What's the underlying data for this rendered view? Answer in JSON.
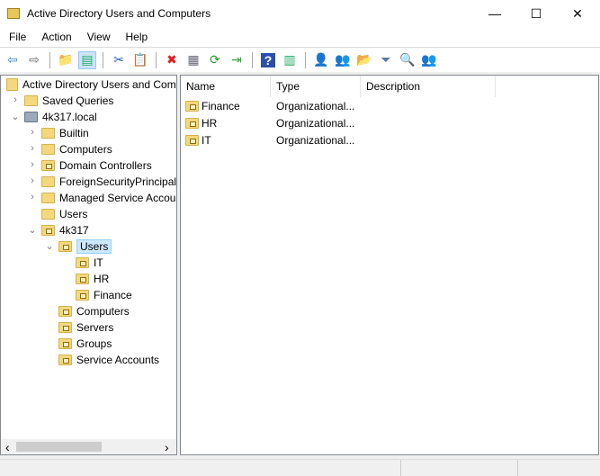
{
  "window": {
    "title": "Active Directory Users and Computers",
    "minimize": "—",
    "maximize": "☐",
    "close": "✕"
  },
  "menu": [
    "File",
    "Action",
    "View",
    "Help"
  ],
  "toolbar": [
    {
      "icon": "back-arrow-icon",
      "glyph": "⇦",
      "color": "#2b7fd8"
    },
    {
      "icon": "forward-arrow-icon",
      "glyph": "⇨",
      "color": "#666"
    },
    {
      "sep": true
    },
    {
      "icon": "up-folder-icon",
      "glyph": "📁",
      "color": "#c9a030"
    },
    {
      "icon": "show-console-tree-icon",
      "glyph": "▤",
      "color": "#2a6",
      "on": true
    },
    {
      "sep": true
    },
    {
      "icon": "cut-icon",
      "glyph": "✂",
      "color": "#2b5fb8"
    },
    {
      "icon": "paste-icon",
      "glyph": "📋",
      "color": "#333"
    },
    {
      "sep": true
    },
    {
      "icon": "delete-icon",
      "glyph": "✖",
      "color": "#e02020"
    },
    {
      "icon": "properties-icon",
      "glyph": "▦",
      "color": "#667"
    },
    {
      "icon": "refresh-icon",
      "glyph": "⟳",
      "color": "#2a9a3a"
    },
    {
      "icon": "export-list-icon",
      "glyph": "⇥",
      "color": "#3a3"
    },
    {
      "sep": true
    },
    {
      "icon": "help-icon",
      "glyph": "?",
      "color": "#fff",
      "bg": "#2a4fae"
    },
    {
      "icon": "show-action-pane-icon",
      "glyph": "▥",
      "color": "#2a6"
    },
    {
      "sep": true
    },
    {
      "icon": "new-user-icon",
      "glyph": "👤",
      "color": "#555"
    },
    {
      "icon": "new-group-icon",
      "glyph": "👥",
      "color": "#555"
    },
    {
      "icon": "new-ou-icon",
      "glyph": "📂",
      "color": "#c9a030"
    },
    {
      "icon": "filter-icon",
      "glyph": "⏷",
      "color": "#5a7a9a"
    },
    {
      "icon": "find-icon",
      "glyph": "🔍",
      "color": "#a08020"
    },
    {
      "icon": "add-to-group-icon",
      "glyph": "👥",
      "color": "#888"
    }
  ],
  "tree": [
    {
      "label": "Active Directory Users and Com",
      "level": 0,
      "icon": "snapin",
      "chev": ""
    },
    {
      "label": "Saved Queries",
      "level": 1,
      "icon": "folder",
      "chev": "›"
    },
    {
      "label": "4k317.local",
      "level": 1,
      "icon": "domain",
      "chev": "⌄"
    },
    {
      "label": "Builtin",
      "level": 2,
      "icon": "folder",
      "chev": "›"
    },
    {
      "label": "Computers",
      "level": 2,
      "icon": "folder",
      "chev": "›"
    },
    {
      "label": "Domain Controllers",
      "level": 2,
      "icon": "ou",
      "chev": "›"
    },
    {
      "label": "ForeignSecurityPrincipals",
      "level": 2,
      "icon": "folder",
      "chev": "›"
    },
    {
      "label": "Managed Service Accounts",
      "level": 2,
      "icon": "folder",
      "chev": "›"
    },
    {
      "label": "Users",
      "level": 2,
      "icon": "folder",
      "chev": ""
    },
    {
      "label": "4k317",
      "level": 2,
      "icon": "ou",
      "chev": "⌄"
    },
    {
      "label": "Users",
      "level": 3,
      "icon": "ou",
      "chev": "⌄",
      "selected": true
    },
    {
      "label": "IT",
      "level": 4,
      "icon": "ou",
      "chev": ""
    },
    {
      "label": "HR",
      "level": 4,
      "icon": "ou",
      "chev": ""
    },
    {
      "label": "Finance",
      "level": 4,
      "icon": "ou",
      "chev": ""
    },
    {
      "label": "Computers",
      "level": 3,
      "icon": "ou",
      "chev": ""
    },
    {
      "label": "Servers",
      "level": 3,
      "icon": "ou",
      "chev": ""
    },
    {
      "label": "Groups",
      "level": 3,
      "icon": "ou",
      "chev": ""
    },
    {
      "label": "Service Accounts",
      "level": 3,
      "icon": "ou",
      "chev": ""
    }
  ],
  "list": {
    "columns": [
      "Name",
      "Type",
      "Description"
    ],
    "rows": [
      {
        "name": "Finance",
        "type": "Organizational...",
        "description": ""
      },
      {
        "name": "HR",
        "type": "Organizational...",
        "description": ""
      },
      {
        "name": "IT",
        "type": "Organizational...",
        "description": ""
      }
    ]
  },
  "scroll": {
    "left": "‹",
    "right": "›"
  }
}
